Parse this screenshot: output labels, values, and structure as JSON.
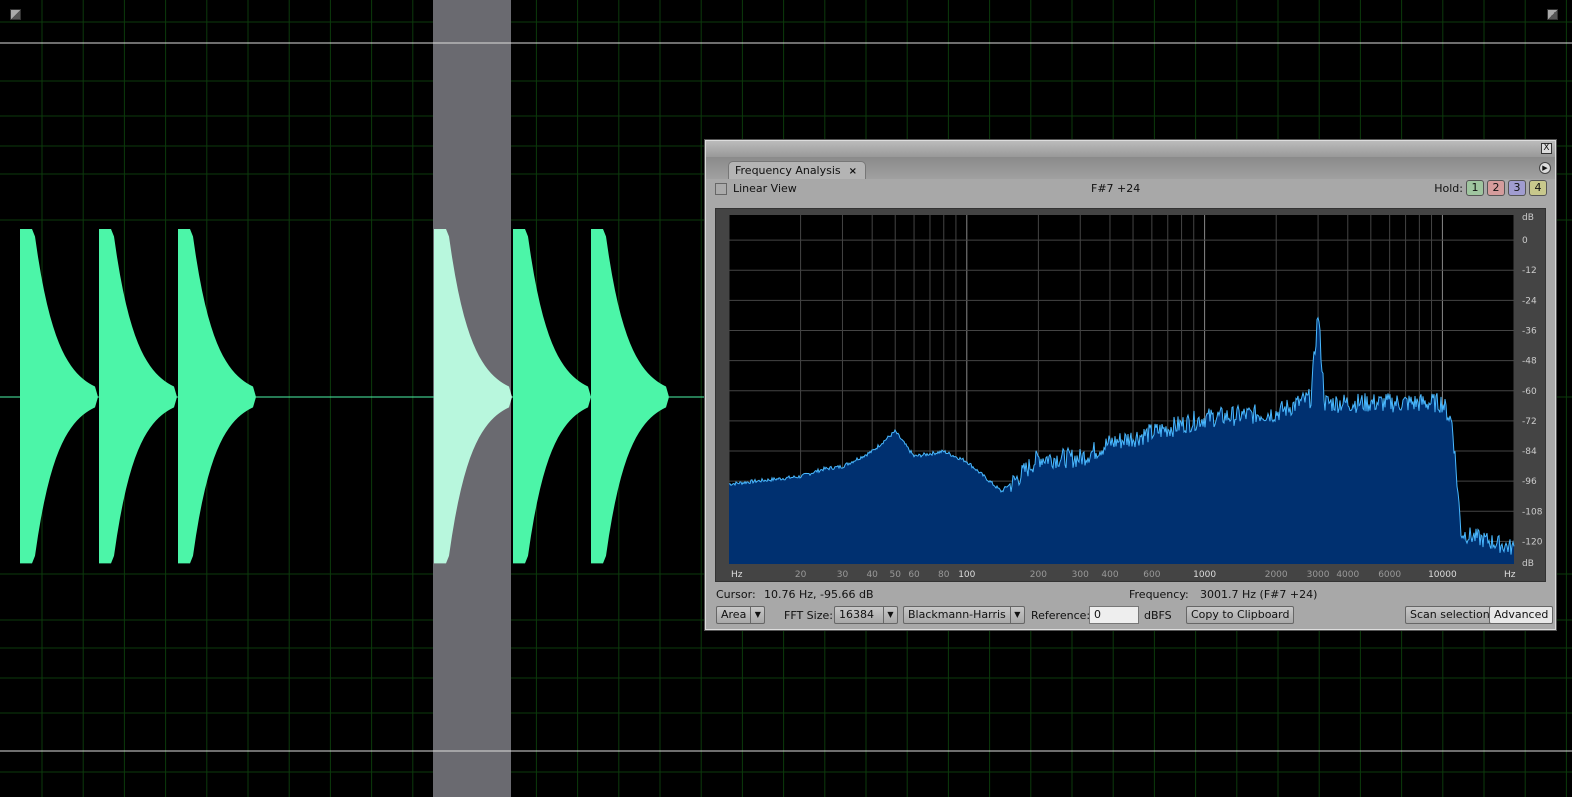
{
  "colors": {
    "waveform": "#4cf5a8",
    "waveform_selected": "#b8f7dd",
    "selection": "#6a6a70",
    "grid": "#0c3a0c",
    "spectrum_fill": "#003070",
    "spectrum_line": "#49b8ff"
  },
  "waveform": {
    "bursts_start_times_rel": [
      0,
      1,
      2,
      5,
      6,
      7
    ],
    "selection_burst": 3
  },
  "panel": {
    "tab_label": "Frequency Analysis",
    "tab_close": "×",
    "close_label": "X",
    "linear_view_label": "Linear View",
    "linear_view_checked": false,
    "note": "F#7 +24",
    "hold_label": "Hold:",
    "hold_buttons": [
      {
        "label": "1",
        "color": "#9fc59f"
      },
      {
        "label": "2",
        "color": "#d49c9c"
      },
      {
        "label": "3",
        "color": "#a09cd0"
      },
      {
        "label": "4",
        "color": "#c8c88c"
      }
    ],
    "cursor_label": "Cursor:",
    "cursor_value": "10.76 Hz, -95.66 dB",
    "frequency_label": "Frequency:",
    "frequency_value": "3001.7 Hz (F#7 +24)",
    "plot_type": "Area",
    "fft_label": "FFT Size:",
    "fft_value": "16384",
    "window": "Blackmann-Harris",
    "reference_label": "Reference:",
    "reference_value": "0",
    "reference_unit": "dBFS",
    "copy_button": "Copy to Clipboard",
    "scan_button": "Scan selection",
    "advanced_button": "Advanced"
  },
  "chart_data": {
    "type": "area",
    "xscale": "log",
    "xlim": [
      10,
      20000
    ],
    "ylim": [
      -129,
      10
    ],
    "xlabel": "Hz",
    "ylabel": "dB",
    "grid": true,
    "x_ticks": [
      "Hz",
      "20",
      "30",
      "40",
      "50",
      "60",
      "80",
      "100",
      "200",
      "300",
      "400",
      "600",
      "1000",
      "2000",
      "3000",
      "4000",
      "6000",
      "10000",
      "Hz"
    ],
    "x_tick_values": [
      10,
      20,
      30,
      40,
      50,
      60,
      80,
      100,
      200,
      300,
      400,
      600,
      1000,
      2000,
      3000,
      4000,
      6000,
      10000,
      20000
    ],
    "y_ticks": [
      "dB",
      "0",
      "-12",
      "-24",
      "-36",
      "-48",
      "-60",
      "-72",
      "-84",
      "-96",
      "-108",
      "-120",
      "dB"
    ],
    "y_tick_values": [
      null,
      0,
      -12,
      -24,
      -36,
      -48,
      -60,
      -72,
      -84,
      -96,
      -108,
      -120,
      null
    ],
    "points": [
      [
        10,
        -97
      ],
      [
        20,
        -94
      ],
      [
        25,
        -91
      ],
      [
        30,
        -90
      ],
      [
        40,
        -84
      ],
      [
        50,
        -76
      ],
      [
        60,
        -86
      ],
      [
        80,
        -84
      ],
      [
        100,
        -88
      ],
      [
        140,
        -100
      ],
      [
        200,
        -86
      ],
      [
        300,
        -86
      ],
      [
        400,
        -80
      ],
      [
        600,
        -76
      ],
      [
        1000,
        -70
      ],
      [
        2000,
        -68
      ],
      [
        2800,
        -62
      ],
      [
        3000,
        -28
      ],
      [
        3200,
        -64
      ],
      [
        5000,
        -64
      ],
      [
        10000,
        -64
      ],
      [
        11000,
        -72
      ],
      [
        12000,
        -116
      ],
      [
        20000,
        -122
      ]
    ]
  }
}
